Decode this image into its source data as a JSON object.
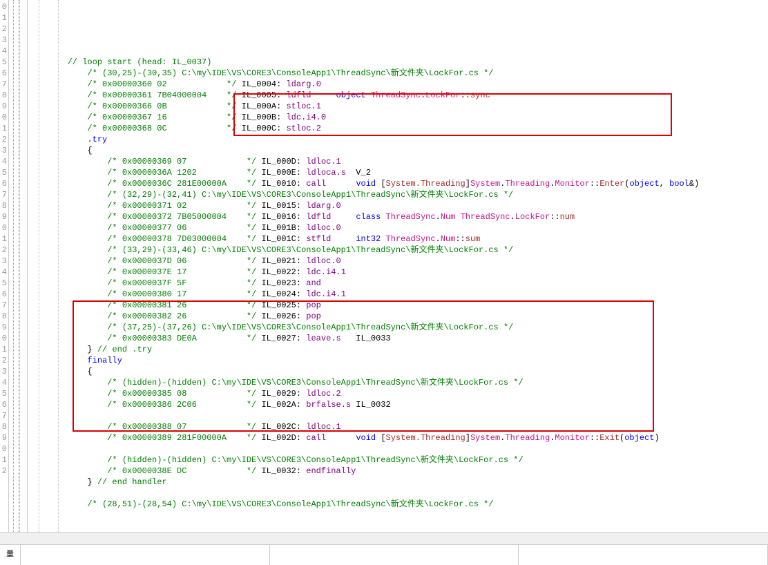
{
  "line_numbers": [
    "0",
    "1",
    "2",
    "3",
    "4",
    "5",
    "6",
    "7",
    "8",
    "9",
    "0",
    "1",
    "2",
    "3",
    "4",
    "5",
    "6",
    "7",
    "8",
    "9",
    "0",
    "1",
    "2",
    "3",
    "4",
    "5",
    "6",
    "7",
    "8",
    "9",
    "0",
    "1",
    "2",
    "3",
    "4",
    "5",
    "6",
    "7",
    "8",
    "9",
    "0",
    "1",
    "2"
  ],
  "lines": [
    {
      "indent": "        ",
      "tokens": [
        {
          "c": "comment",
          "t": "// loop start (head: IL_0037)"
        }
      ]
    },
    {
      "indent": "            ",
      "tokens": [
        {
          "c": "comment",
          "t": "/* (30,25)-(30,35) C:\\my\\IDE\\VS\\CORE3\\ConsoleApp1\\ThreadSync\\新文件夹\\LockFor.cs */"
        }
      ]
    },
    {
      "indent": "            ",
      "tokens": [
        {
          "c": "comment",
          "t": "/* 0x00000360 02            */"
        },
        {
          "c": "",
          "t": " IL_0004: "
        },
        {
          "c": "op",
          "t": "ldarg.0"
        }
      ]
    },
    {
      "indent": "            ",
      "tokens": [
        {
          "c": "comment",
          "t": "/* 0x00000361 7B04000004    */"
        },
        {
          "c": "",
          "t": " IL_0005: "
        },
        {
          "c": "op",
          "t": "ldfld"
        },
        {
          "c": "",
          "t": "     "
        },
        {
          "c": "kw",
          "t": "object"
        },
        {
          "c": "",
          "t": " "
        },
        {
          "c": "pink",
          "t": "ThreadSync"
        },
        {
          "c": "",
          "t": "."
        },
        {
          "c": "pink",
          "t": "LockFor"
        },
        {
          "c": "",
          "t": "::"
        },
        {
          "c": "brown",
          "t": "sync"
        }
      ]
    },
    {
      "indent": "            ",
      "tokens": [
        {
          "c": "comment",
          "t": "/* 0x00000366 0B            */"
        },
        {
          "c": "",
          "t": " IL_000A: "
        },
        {
          "c": "op",
          "t": "stloc.1"
        }
      ]
    },
    {
      "indent": "            ",
      "tokens": [
        {
          "c": "comment",
          "t": "/* 0x00000367 16            */"
        },
        {
          "c": "",
          "t": " IL_000B: "
        },
        {
          "c": "op",
          "t": "ldc.i4.0"
        }
      ]
    },
    {
      "indent": "            ",
      "tokens": [
        {
          "c": "comment",
          "t": "/* 0x00000368 0C            */"
        },
        {
          "c": "",
          "t": " IL_000C: "
        },
        {
          "c": "op",
          "t": "stloc.2"
        }
      ]
    },
    {
      "indent": "            ",
      "tokens": [
        {
          "c": "kw",
          "t": ".try"
        }
      ]
    },
    {
      "indent": "            ",
      "tokens": [
        {
          "c": "",
          "t": "{"
        }
      ]
    },
    {
      "indent": "                ",
      "tokens": [
        {
          "c": "comment",
          "t": "/* 0x00000369 07            */"
        },
        {
          "c": "",
          "t": " IL_000D: "
        },
        {
          "c": "op",
          "t": "ldloc.1"
        }
      ]
    },
    {
      "indent": "                ",
      "tokens": [
        {
          "c": "comment",
          "t": "/* 0x0000036A 1202          */"
        },
        {
          "c": "",
          "t": " IL_000E: "
        },
        {
          "c": "op",
          "t": "ldloca.s"
        },
        {
          "c": "",
          "t": "  V_2"
        }
      ]
    },
    {
      "indent": "                ",
      "tokens": [
        {
          "c": "comment",
          "t": "/* 0x0000036C 281E00000A    */"
        },
        {
          "c": "",
          "t": " IL_0010: "
        },
        {
          "c": "op",
          "t": "call"
        },
        {
          "c": "",
          "t": "      "
        },
        {
          "c": "kw",
          "t": "void"
        },
        {
          "c": "",
          "t": " ["
        },
        {
          "c": "brown",
          "t": "System.Threading"
        },
        {
          "c": "",
          "t": "]"
        },
        {
          "c": "pink",
          "t": "System"
        },
        {
          "c": "",
          "t": "."
        },
        {
          "c": "pink",
          "t": "Threading"
        },
        {
          "c": "",
          "t": "."
        },
        {
          "c": "pink",
          "t": "Monitor"
        },
        {
          "c": "",
          "t": "::"
        },
        {
          "c": "brown",
          "t": "Enter"
        },
        {
          "c": "",
          "t": "("
        },
        {
          "c": "kw",
          "t": "object"
        },
        {
          "c": "",
          "t": ", "
        },
        {
          "c": "kw",
          "t": "bool"
        },
        {
          "c": "",
          "t": "&)"
        }
      ]
    },
    {
      "indent": "                ",
      "tokens": [
        {
          "c": "comment",
          "t": "/* (32,29)-(32,41) C:\\my\\IDE\\VS\\CORE3\\ConsoleApp1\\ThreadSync\\新文件夹\\LockFor.cs */"
        }
      ]
    },
    {
      "indent": "                ",
      "tokens": [
        {
          "c": "comment",
          "t": "/* 0x00000371 02            */"
        },
        {
          "c": "",
          "t": " IL_0015: "
        },
        {
          "c": "op",
          "t": "ldarg.0"
        }
      ]
    },
    {
      "indent": "                ",
      "tokens": [
        {
          "c": "comment",
          "t": "/* 0x00000372 7B05000004    */"
        },
        {
          "c": "",
          "t": " IL_0016: "
        },
        {
          "c": "op",
          "t": "ldfld"
        },
        {
          "c": "",
          "t": "     "
        },
        {
          "c": "kw",
          "t": "class"
        },
        {
          "c": "",
          "t": " "
        },
        {
          "c": "pink",
          "t": "ThreadSync"
        },
        {
          "c": "",
          "t": "."
        },
        {
          "c": "pink",
          "t": "Num"
        },
        {
          "c": "",
          "t": " "
        },
        {
          "c": "pink",
          "t": "ThreadSync"
        },
        {
          "c": "",
          "t": "."
        },
        {
          "c": "pink",
          "t": "LockFor"
        },
        {
          "c": "",
          "t": "::"
        },
        {
          "c": "brown",
          "t": "num"
        }
      ]
    },
    {
      "indent": "                ",
      "tokens": [
        {
          "c": "comment",
          "t": "/* 0x00000377 06            */"
        },
        {
          "c": "",
          "t": " IL_001B: "
        },
        {
          "c": "op",
          "t": "ldloc.0"
        }
      ]
    },
    {
      "indent": "                ",
      "tokens": [
        {
          "c": "comment",
          "t": "/* 0x00000378 7D03000004    */"
        },
        {
          "c": "",
          "t": " IL_001C: "
        },
        {
          "c": "op",
          "t": "stfld"
        },
        {
          "c": "",
          "t": "     "
        },
        {
          "c": "kw",
          "t": "int32"
        },
        {
          "c": "",
          "t": " "
        },
        {
          "c": "pink",
          "t": "ThreadSync"
        },
        {
          "c": "",
          "t": "."
        },
        {
          "c": "pink",
          "t": "Num"
        },
        {
          "c": "",
          "t": "::"
        },
        {
          "c": "brown",
          "t": "sum"
        }
      ]
    },
    {
      "indent": "                ",
      "tokens": [
        {
          "c": "comment",
          "t": "/* (33,29)-(33,46) C:\\my\\IDE\\VS\\CORE3\\ConsoleApp1\\ThreadSync\\新文件夹\\LockFor.cs */"
        }
      ]
    },
    {
      "indent": "                ",
      "tokens": [
        {
          "c": "comment",
          "t": "/* 0x0000037D 06            */"
        },
        {
          "c": "",
          "t": " IL_0021: "
        },
        {
          "c": "op",
          "t": "ldloc.0"
        }
      ]
    },
    {
      "indent": "                ",
      "tokens": [
        {
          "c": "comment",
          "t": "/* 0x0000037E 17            */"
        },
        {
          "c": "",
          "t": " IL_0022: "
        },
        {
          "c": "op",
          "t": "ldc.i4.1"
        }
      ]
    },
    {
      "indent": "                ",
      "tokens": [
        {
          "c": "comment",
          "t": "/* 0x0000037F 5F            */"
        },
        {
          "c": "",
          "t": " IL_0023: "
        },
        {
          "c": "op",
          "t": "and"
        }
      ]
    },
    {
      "indent": "                ",
      "tokens": [
        {
          "c": "comment",
          "t": "/* 0x00000380 17            */"
        },
        {
          "c": "",
          "t": " IL_0024: "
        },
        {
          "c": "op",
          "t": "ldc.i4.1"
        }
      ]
    },
    {
      "indent": "                ",
      "tokens": [
        {
          "c": "comment",
          "t": "/* 0x00000381 26            */"
        },
        {
          "c": "",
          "t": " IL_0025: "
        },
        {
          "c": "op",
          "t": "pop"
        }
      ]
    },
    {
      "indent": "                ",
      "tokens": [
        {
          "c": "comment",
          "t": "/* 0x00000382 26            */"
        },
        {
          "c": "",
          "t": " IL_0026: "
        },
        {
          "c": "op",
          "t": "pop"
        }
      ]
    },
    {
      "indent": "                ",
      "tokens": [
        {
          "c": "comment",
          "t": "/* (37,25)-(37,26) C:\\my\\IDE\\VS\\CORE3\\ConsoleApp1\\ThreadSync\\新文件夹\\LockFor.cs */"
        }
      ]
    },
    {
      "indent": "                ",
      "tokens": [
        {
          "c": "comment",
          "t": "/* 0x00000383 DE0A          */"
        },
        {
          "c": "",
          "t": " IL_0027: "
        },
        {
          "c": "op",
          "t": "leave.s"
        },
        {
          "c": "",
          "t": "   IL_0033"
        }
      ]
    },
    {
      "indent": "            ",
      "tokens": [
        {
          "c": "",
          "t": "} "
        },
        {
          "c": "comment",
          "t": "// end .try"
        }
      ]
    },
    {
      "indent": "            ",
      "tokens": [
        {
          "c": "kw",
          "t": "finally"
        }
      ]
    },
    {
      "indent": "            ",
      "tokens": [
        {
          "c": "",
          "t": "{"
        }
      ]
    },
    {
      "indent": "                ",
      "tokens": [
        {
          "c": "comment",
          "t": "/* (hidden)-(hidden) C:\\my\\IDE\\VS\\CORE3\\ConsoleApp1\\ThreadSync\\新文件夹\\LockFor.cs */"
        }
      ]
    },
    {
      "indent": "                ",
      "tokens": [
        {
          "c": "comment",
          "t": "/* 0x00000385 08            */"
        },
        {
          "c": "",
          "t": " IL_0029: "
        },
        {
          "c": "op",
          "t": "ldloc.2"
        }
      ]
    },
    {
      "indent": "                ",
      "tokens": [
        {
          "c": "comment",
          "t": "/* 0x00000386 2C06          */"
        },
        {
          "c": "",
          "t": " IL_002A: "
        },
        {
          "c": "op",
          "t": "brfalse.s"
        },
        {
          "c": "",
          "t": " IL_0032"
        }
      ]
    },
    {
      "indent": "",
      "tokens": [
        {
          "c": "",
          "t": ""
        }
      ]
    },
    {
      "indent": "                ",
      "tokens": [
        {
          "c": "comment",
          "t": "/* 0x00000388 07            */"
        },
        {
          "c": "",
          "t": " IL_002C: "
        },
        {
          "c": "op",
          "t": "ldloc.1"
        }
      ]
    },
    {
      "indent": "                ",
      "tokens": [
        {
          "c": "comment",
          "t": "/* 0x00000389 281F00000A    */"
        },
        {
          "c": "",
          "t": " IL_002D: "
        },
        {
          "c": "op",
          "t": "call"
        },
        {
          "c": "",
          "t": "      "
        },
        {
          "c": "kw",
          "t": "void"
        },
        {
          "c": "",
          "t": " ["
        },
        {
          "c": "brown",
          "t": "System.Threading"
        },
        {
          "c": "",
          "t": "]"
        },
        {
          "c": "pink",
          "t": "System"
        },
        {
          "c": "",
          "t": "."
        },
        {
          "c": "pink",
          "t": "Threading"
        },
        {
          "c": "",
          "t": "."
        },
        {
          "c": "pink",
          "t": "Monitor"
        },
        {
          "c": "",
          "t": "::"
        },
        {
          "c": "brown",
          "t": "Exit"
        },
        {
          "c": "",
          "t": "("
        },
        {
          "c": "kw",
          "t": "object"
        },
        {
          "c": "",
          "t": ")"
        }
      ]
    },
    {
      "indent": "",
      "tokens": [
        {
          "c": "",
          "t": ""
        }
      ]
    },
    {
      "indent": "                ",
      "tokens": [
        {
          "c": "comment",
          "t": "/* (hidden)-(hidden) C:\\my\\IDE\\VS\\CORE3\\ConsoleApp1\\ThreadSync\\新文件夹\\LockFor.cs */"
        }
      ]
    },
    {
      "indent": "                ",
      "tokens": [
        {
          "c": "comment",
          "t": "/* 0x0000038E DC            */"
        },
        {
          "c": "",
          "t": " IL_0032: "
        },
        {
          "c": "op",
          "t": "endfinally"
        }
      ]
    },
    {
      "indent": "            ",
      "tokens": [
        {
          "c": "",
          "t": "} "
        },
        {
          "c": "comment",
          "t": "// end handler"
        }
      ]
    },
    {
      "indent": "",
      "tokens": [
        {
          "c": "",
          "t": ""
        }
      ]
    },
    {
      "indent": "            ",
      "tokens": [
        {
          "c": "comment",
          "t": "/* (28,51)-(28,54) C:\\my\\IDE\\VS\\CORE3\\ConsoleApp1\\ThreadSync\\新文件夹\\LockFor.cs */"
        }
      ]
    },
    {
      "indent": "",
      "tokens": [
        {
          "c": "",
          "t": ""
        }
      ]
    },
    {
      "indent": "",
      "tokens": [
        {
          "c": "",
          "t": ""
        }
      ]
    }
  ],
  "icon_label": "量"
}
